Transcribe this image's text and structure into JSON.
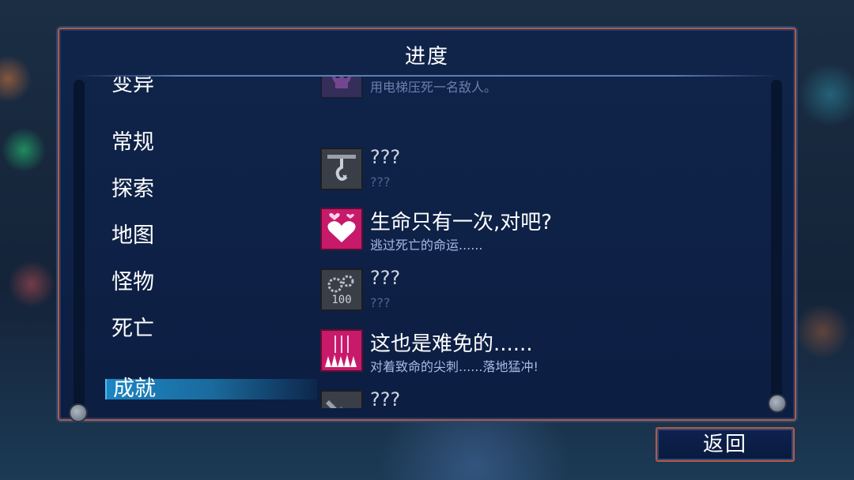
{
  "panel": {
    "title": "进度"
  },
  "categories": {
    "items": [
      {
        "label": "变异",
        "selected": false
      },
      {
        "label": "常规",
        "selected": false
      },
      {
        "label": "探索",
        "selected": false
      },
      {
        "label": "地图",
        "selected": false
      },
      {
        "label": "怪物",
        "selected": false
      },
      {
        "label": "死亡",
        "selected": false
      },
      {
        "label": "成就",
        "selected": true
      }
    ]
  },
  "achievements": {
    "items": [
      {
        "title": "",
        "desc": "用电梯压死一名敌人。",
        "icon": "skull-icon",
        "unlocked": true
      },
      {
        "title": "???",
        "desc": "???",
        "icon": "hanging-rope-icon",
        "unlocked": false
      },
      {
        "title": "生命只有一次,对吧?",
        "desc": "逃过死亡的命运......",
        "icon": "hearts-icon",
        "unlocked": true
      },
      {
        "title": "???",
        "desc": "???",
        "icon": "gears-100-icon",
        "unlocked": false
      },
      {
        "title": "这也是难免的......",
        "desc": "对着致命的尖刺......落地猛冲!",
        "icon": "spikes-icon",
        "unlocked": true
      },
      {
        "title": "???",
        "desc": "???",
        "icon": "broken-blade-icon",
        "unlocked": false
      }
    ],
    "icon_label_100": "100"
  },
  "footer": {
    "back_label": "返回"
  },
  "colors": {
    "frame": "#b8573f",
    "panel_bg": "#0c1e42",
    "selected_bar": "#1c86c4",
    "unlocked_icon": "#c71a6a",
    "desc_text": "#a9b8e6"
  }
}
